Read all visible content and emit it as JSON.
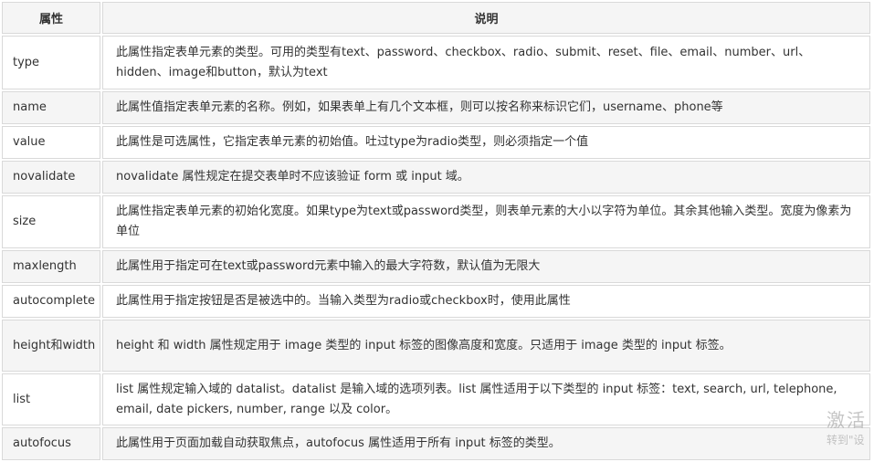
{
  "table": {
    "headers": {
      "attr": "属性",
      "desc": "说明"
    },
    "rows": [
      {
        "attr": "type",
        "desc": "此属性指定表单元素的类型。可用的类型有text、password、checkbox、radio、submit、reset、file、email、number、url、hidden、image和button，默认为text"
      },
      {
        "attr": "name",
        "desc": "此属性值指定表单元素的名称。例如，如果表单上有几个文本框，则可以按名称来标识它们，username、phone等"
      },
      {
        "attr": "value",
        "desc": "此属性是可选属性，它指定表单元素的初始值。吐过type为radio类型，则必须指定一个值"
      },
      {
        "attr": "novalidate",
        "desc": "novalidate 属性规定在提交表单时不应该验证 form 或 input 域。"
      },
      {
        "attr": "size",
        "desc": "此属性指定表单元素的初始化宽度。如果type为text或password类型，则表单元素的大小以字符为单位。其余其他输入类型。宽度为像素为单位"
      },
      {
        "attr": "maxlength",
        "desc": "此属性用于指定可在text或password元素中输入的最大字符数，默认值为无限大"
      },
      {
        "attr": "autocomplete",
        "desc": "此属性用于指定按钮是否是被选中的。当输入类型为radio或checkbox时，使用此属性"
      },
      {
        "attr": "height和width",
        "desc": "height 和 width 属性规定用于 image 类型的 input 标签的图像高度和宽度。只适用于 image 类型的 input 标签。"
      },
      {
        "attr": "list",
        "desc": "list 属性规定输入域的 datalist。datalist 是输入域的选项列表。list 属性适用于以下类型的 input 标签：text, search, url, telephone, email, date pickers, number, range 以及 color。"
      },
      {
        "attr": "autofocus",
        "desc": "此属性用于页面加载自动获取焦点，autofocus 属性适用于所有 input 标签的类型。"
      }
    ]
  },
  "watermark": {
    "line1": "激活 W",
    "line2": "转到\"设"
  }
}
